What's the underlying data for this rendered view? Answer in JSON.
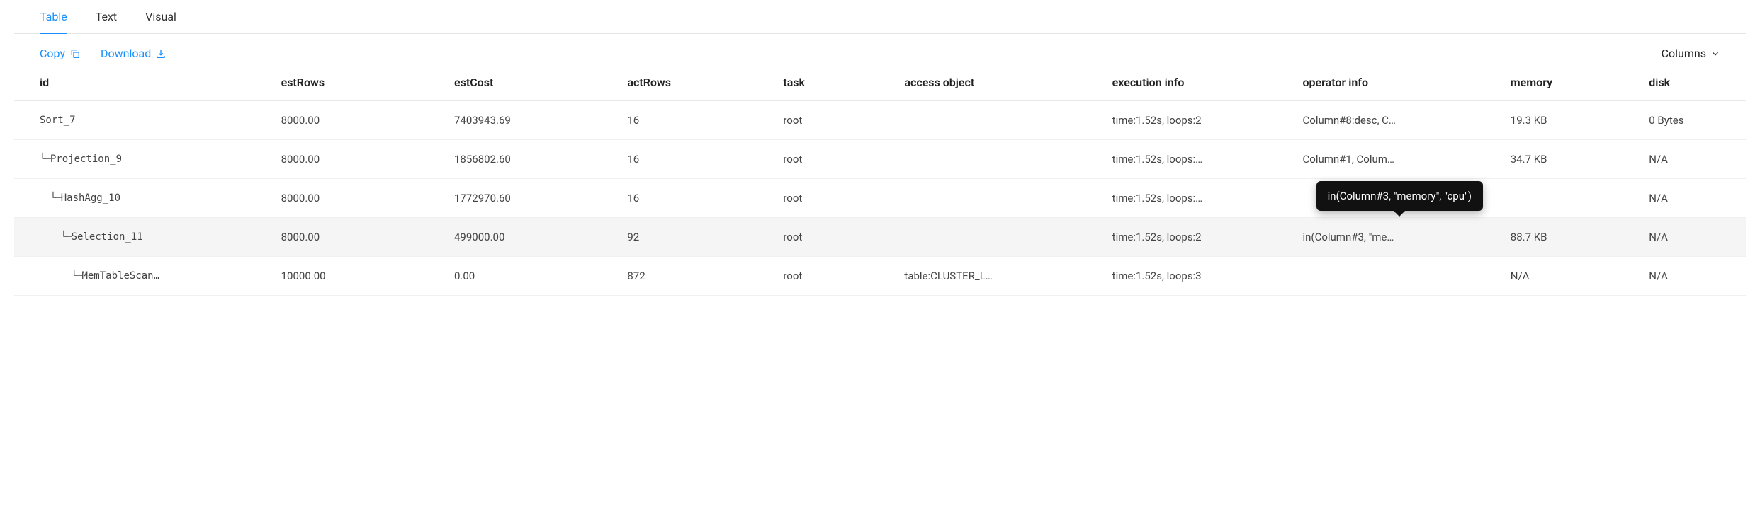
{
  "tabs": [
    {
      "label": "Table",
      "active": true
    },
    {
      "label": "Text",
      "active": false
    },
    {
      "label": "Visual",
      "active": false
    }
  ],
  "toolbar": {
    "copy_label": "Copy",
    "download_label": "Download",
    "columns_label": "Columns"
  },
  "columns": [
    {
      "key": "id",
      "label": "id",
      "width": "15%"
    },
    {
      "key": "estRows",
      "label": "estRows",
      "width": "10%"
    },
    {
      "key": "estCost",
      "label": "estCost",
      "width": "10%"
    },
    {
      "key": "actRows",
      "label": "actRows",
      "width": "9%"
    },
    {
      "key": "task",
      "label": "task",
      "width": "7%"
    },
    {
      "key": "access_object",
      "label": "access object",
      "width": "12%"
    },
    {
      "key": "execution_info",
      "label": "execution info",
      "width": "11%"
    },
    {
      "key": "operator_info",
      "label": "operator info",
      "width": "12%"
    },
    {
      "key": "memory",
      "label": "memory",
      "width": "8%"
    },
    {
      "key": "disk",
      "label": "disk",
      "width": "6%"
    }
  ],
  "rows": [
    {
      "indent": 0,
      "id": "Sort_7",
      "estRows": "8000.00",
      "estCost": "7403943.69",
      "actRows": "16",
      "task": "root",
      "access_object": "",
      "execution_info": "time:1.52s, loops:2",
      "operator_info": "Column#8:desc, C…",
      "memory": "19.3 KB",
      "disk": "0 Bytes",
      "hovered": false
    },
    {
      "indent": 1,
      "id": "Projection_9",
      "estRows": "8000.00",
      "estCost": "1856802.60",
      "actRows": "16",
      "task": "root",
      "access_object": "",
      "execution_info": "time:1.52s, loops:…",
      "operator_info": "Column#1, Colum…",
      "memory": "34.7 KB",
      "disk": "N/A",
      "hovered": false
    },
    {
      "indent": 2,
      "id": "HashAgg_10",
      "estRows": "8000.00",
      "estCost": "1772970.60",
      "actRows": "16",
      "task": "root",
      "access_object": "",
      "execution_info": "time:1.52s, loops:…",
      "operator_info": "",
      "memory": "",
      "disk": "N/A",
      "hovered": false
    },
    {
      "indent": 3,
      "id": "Selection_11",
      "estRows": "8000.00",
      "estCost": "499000.00",
      "actRows": "92",
      "task": "root",
      "access_object": "",
      "execution_info": "time:1.52s, loops:2",
      "operator_info": "in(Column#3, \"me…",
      "memory": "88.7 KB",
      "disk": "N/A",
      "hovered": true
    },
    {
      "indent": 4,
      "id": "MemTableScan…",
      "estRows": "10000.00",
      "estCost": "0.00",
      "actRows": "872",
      "task": "root",
      "access_object": "table:CLUSTER_L…",
      "execution_info": "time:1.52s, loops:3",
      "operator_info": "",
      "memory": "N/A",
      "disk": "N/A",
      "hovered": false
    }
  ],
  "tooltip": {
    "text": "in(Column#3, \"memory\", \"cpu\")",
    "row_index": 3,
    "column_key": "operator_info"
  }
}
